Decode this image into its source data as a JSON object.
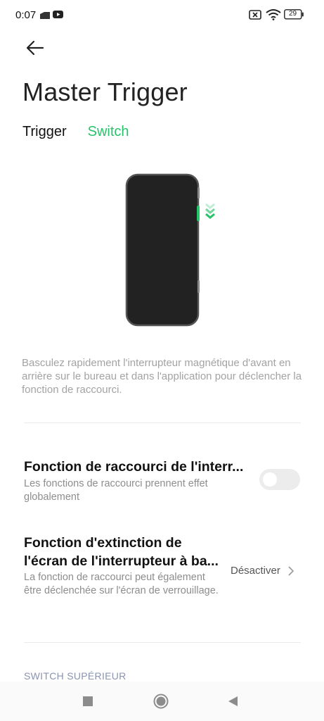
{
  "status_bar": {
    "time": "0:07",
    "battery": "29",
    "icons": [
      "message-icon",
      "youtube-icon",
      "no-sim-icon",
      "wifi-icon",
      "battery-icon"
    ]
  },
  "header": {
    "back_icon": "arrow-left-icon",
    "title": "Master Trigger"
  },
  "tabs": [
    {
      "label": "Trigger",
      "active": false
    },
    {
      "label": "Switch",
      "active": true
    }
  ],
  "accent_color": "#27c26c",
  "description": "Basculez rapidement l'interrupteur magnétique d'avant en arrière sur le bureau et dans l'application pour déclencher la fonction de raccourci.",
  "settings": [
    {
      "title": "Fonction de raccourci de l'interr...",
      "subtitle": "Les fonctions de raccourci prennent effet globalement",
      "control": "toggle",
      "enabled": false
    },
    {
      "title": "Fonction d'extinction de l'écran de l'interrupteur à ba...",
      "subtitle": "La fonction de raccourci peut également être déclenchée sur l'écran de verrouillage.",
      "control": "select",
      "value": "Désactiver"
    }
  ],
  "section_label": "SWITCH SUPÉRIEUR",
  "nav_bar": {
    "buttons": [
      "recents-icon",
      "home-icon",
      "back-triangle-icon"
    ]
  }
}
